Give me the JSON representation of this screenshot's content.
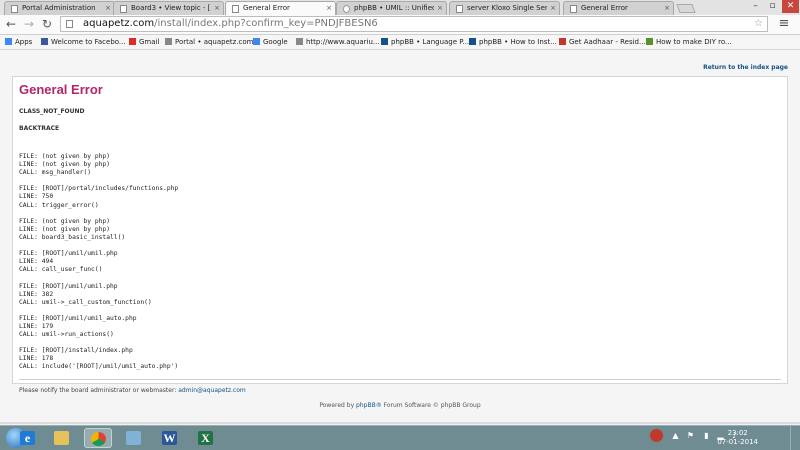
{
  "browser": {
    "tabs": [
      {
        "label": "Portal Administration",
        "active": false
      },
      {
        "label": "Board3 • View topic - [RE",
        "active": false
      },
      {
        "label": "General Error",
        "active": true
      },
      {
        "label": "phpBB • UMIL :: Unified M",
        "active": false
      },
      {
        "label": "server Kloxo Single Server",
        "active": false
      },
      {
        "label": "General Error",
        "active": false
      }
    ],
    "tab_close_glyph": "×",
    "window_controls": {
      "minimize": "–",
      "restore": "▫",
      "close": "✕"
    },
    "nav": {
      "back": "←",
      "forward": "→",
      "reload": "↻",
      "menu": "≡"
    },
    "url_host": "aquapetz.com",
    "url_rest": "/install/index.php?confirm_key=PNDJFBESN6",
    "bookmarks": [
      {
        "label": "Apps",
        "icon": "apps-grid-icon",
        "color": "#4285f4"
      },
      {
        "label": "Welcome to Facebo...",
        "icon": "facebook-icon",
        "color": "#3b5998"
      },
      {
        "label": "Gmail",
        "icon": "gmail-icon",
        "color": "#d93025"
      },
      {
        "label": "Portal • aquapetz.com",
        "icon": "page-icon",
        "color": "#888888"
      },
      {
        "label": "Google",
        "icon": "google-icon",
        "color": "#4285f4"
      },
      {
        "label": "http://www.aquariu...",
        "icon": "page-icon",
        "color": "#888888"
      },
      {
        "label": "phpBB • Language P...",
        "icon": "phpbb-icon",
        "color": "#105289"
      },
      {
        "label": "phpBB • How to Inst...",
        "icon": "phpbb-icon",
        "color": "#105289"
      },
      {
        "label": "Get Aadhaar - Resid...",
        "icon": "aadhaar-icon",
        "color": "#c0392b"
      },
      {
        "label": "How to make DIY ro...",
        "icon": "wikihow-icon",
        "color": "#5a8f29"
      }
    ]
  },
  "page": {
    "return_link": "Return to the index page",
    "title": "General Error",
    "error_code": "CLASS_NOT_FOUND",
    "backtrace_heading": "BACKTRACE",
    "trace": "FILE: (not given by php)\nLINE: (not given by php)\nCALL: msg_handler()\n\nFILE: [ROOT]/portal/includes/functions.php\nLINE: 750\nCALL: trigger_error()\n\nFILE: (not given by php)\nLINE: (not given by php)\nCALL: board3_basic_install()\n\nFILE: [ROOT]/umil/umil.php\nLINE: 494\nCALL: call_user_func()\n\nFILE: [ROOT]/umil/umil.php\nLINE: 382\nCALL: umil->_call_custom_function()\n\nFILE: [ROOT]/umil/umil_auto.php\nLINE: 179\nCALL: umil->run_actions()\n\nFILE: [ROOT]/install/index.php\nLINE: 178\nCALL: include('[ROOT]/umil/umil_auto.php')",
    "notify_text": "Please notify the board administrator or webmaster: ",
    "notify_email": "admin@aquapetz.com",
    "powered_prefix": "Powered by ",
    "powered_link": "phpBB®",
    "powered_suffix": " Forum Software © phpBB Group"
  },
  "taskbar": {
    "apps": [
      {
        "name": "internet-explorer-icon",
        "glyph": "e",
        "color": "#1f7bd6",
        "active": false
      },
      {
        "name": "file-explorer-icon",
        "glyph": "",
        "color": "#e6c25a",
        "active": false
      },
      {
        "name": "chrome-icon",
        "glyph": "",
        "color": "#db4437",
        "active": true
      },
      {
        "name": "paint-icon",
        "glyph": "",
        "color": "#7fb3d5",
        "active": false
      },
      {
        "name": "word-icon",
        "glyph": "W",
        "color": "#2b579a",
        "active": false
      },
      {
        "name": "excel-icon",
        "glyph": "X",
        "color": "#217346",
        "active": false
      }
    ],
    "clock_time": "23:02",
    "clock_date": "07-01-2014"
  }
}
